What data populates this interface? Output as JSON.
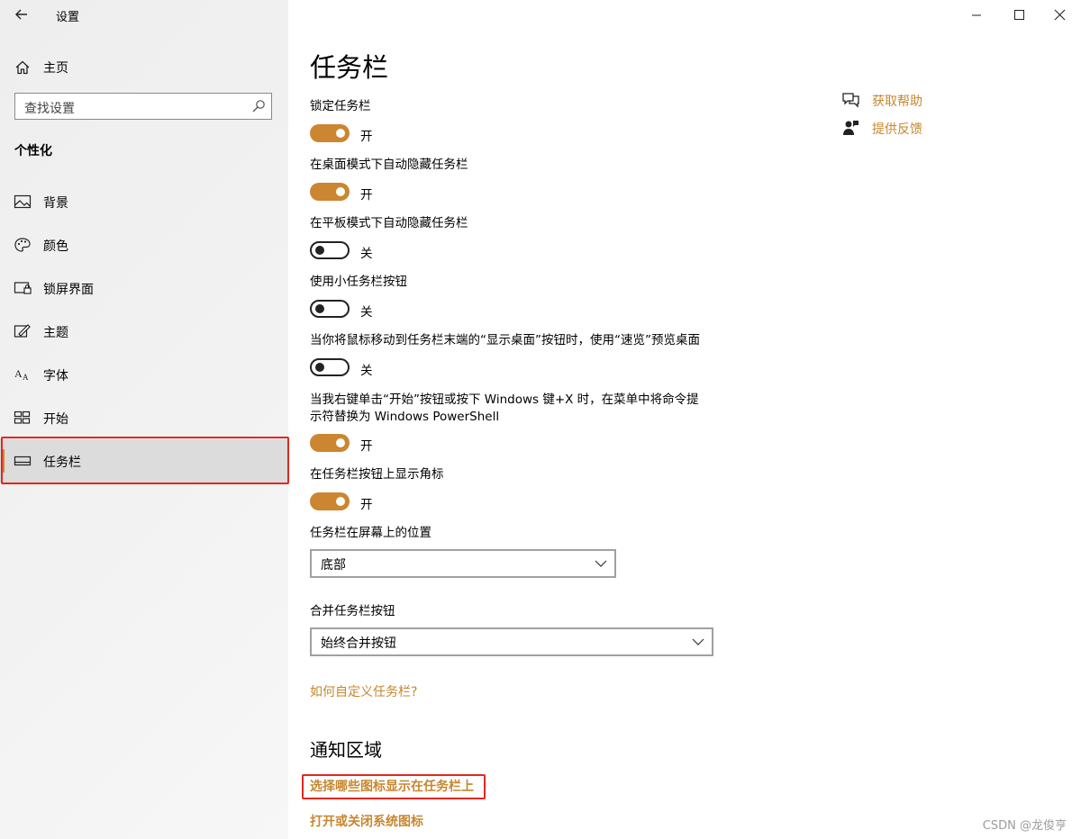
{
  "window": {
    "title": "设置",
    "controls": [
      "minimize-icon",
      "maximize-icon",
      "close-icon"
    ]
  },
  "sidebar": {
    "home_label": "主页",
    "search_placeholder": "查找设置",
    "section_title": "个性化",
    "items": [
      {
        "label": "背景",
        "icon": "picture-icon"
      },
      {
        "label": "颜色",
        "icon": "palette-icon"
      },
      {
        "label": "锁屏界面",
        "icon": "lock-screen-icon"
      },
      {
        "label": "主题",
        "icon": "theme-icon"
      },
      {
        "label": "字体",
        "icon": "font-icon"
      },
      {
        "label": "开始",
        "icon": "start-icon"
      },
      {
        "label": "任务栏",
        "icon": "taskbar-icon",
        "selected": true
      }
    ]
  },
  "main": {
    "title": "任务栏",
    "settings": [
      {
        "label": "锁定任务栏",
        "on": true,
        "state": "开"
      },
      {
        "label": "在桌面模式下自动隐藏任务栏",
        "on": true,
        "state": "开"
      },
      {
        "label": "在平板模式下自动隐藏任务栏",
        "on": false,
        "state": "关"
      },
      {
        "label": "使用小任务栏按钮",
        "on": false,
        "state": "关"
      },
      {
        "label": "当你将鼠标移动到任务栏末端的“显示桌面”按钮时，使用“速览”预览桌面",
        "on": false,
        "state": "关"
      },
      {
        "label_line1": "当我右键单击“开始”按钮或按下 Windows 键+X 时，在菜单中将命令提",
        "label_line2": "示符替换为 Windows PowerShell",
        "on": true,
        "state": "开"
      },
      {
        "label": "在任务栏按钮上显示角标",
        "on": true,
        "state": "开"
      }
    ],
    "position": {
      "label": "任务栏在屏幕上的位置",
      "value": "底部"
    },
    "combine": {
      "label": "合并任务栏按钮",
      "value": "始终合并按钮"
    },
    "customize_link": "如何自定义任务栏?",
    "notification_heading": "通知区域",
    "notification_links": [
      "选择哪些图标显示在任务栏上",
      "打开或关闭系统图标"
    ]
  },
  "help": {
    "get_help": "获取帮助",
    "feedback": "提供反馈"
  },
  "colors": {
    "accent": "#cc8530",
    "link": "#c8862e",
    "highlight_box": "#e5251e"
  },
  "watermark": "CSDN @龙俊亨"
}
